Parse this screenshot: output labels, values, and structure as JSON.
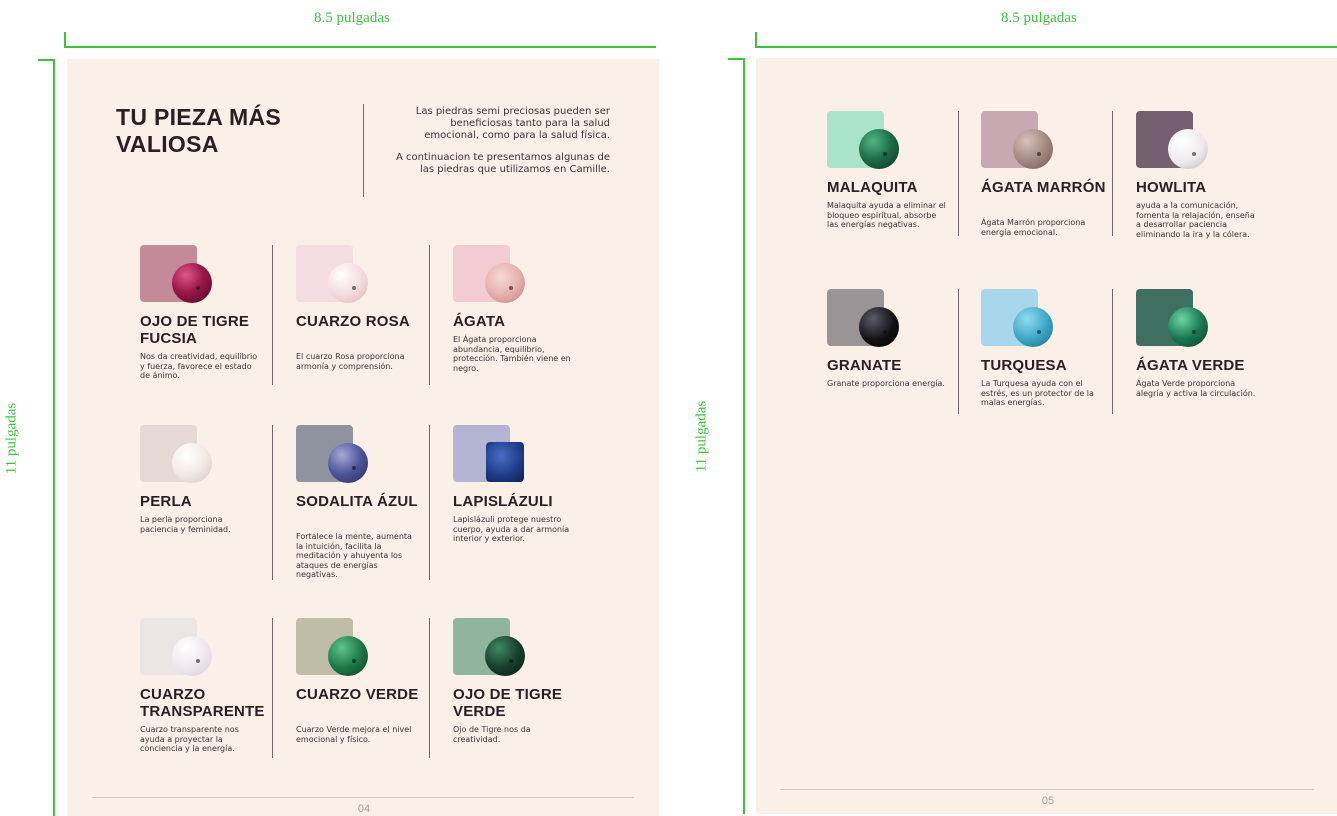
{
  "annotations": {
    "width_label": "8.5 pulgadas",
    "height_label": "11 pulgadas"
  },
  "colors": {
    "page_background": "#faf0e8",
    "measure_guides": "#3cc33c",
    "heading_text": "#2a1e22"
  },
  "page_left": {
    "title": "TU PIEZA MÁS VALIOSA",
    "intro_paragraph_1": "Las piedras semi preciosas pueden ser beneficiosas tanto para la salud emocional, como para la salud física.",
    "intro_paragraph_2": "A continuacion te presentamos algunas de las piedras que utilizamos en Camille.",
    "page_number": "04",
    "stones": [
      {
        "name": "OJO DE TIGRE FUCSIA",
        "description": "Nos da creatividad, equilibrio y fuerza, favorece el estado de ánimo.",
        "swatch_color": "#c48a99",
        "bead_color": "#9c1848"
      },
      {
        "name": "CUARZO ROSA",
        "description": "El cuarzo Rosa proporciona armonía y comprensión.",
        "swatch_color": "#f3dde3",
        "bead_color": "#f4dcdf"
      },
      {
        "name": "ÁGATA",
        "description": "El Ágata proporciona abundancia, equilibrio, protección. También viene en negro.",
        "swatch_color": "#f2ccd1",
        "bead_color": "#e8b6b4"
      },
      {
        "name": "PERLA",
        "description": "La perla proporciona paciencia y feminidad.",
        "swatch_color": "#e6d9d3",
        "bead_color": "#f2ebe8"
      },
      {
        "name": "SODALITA ÁZUL",
        "description": "Fortalece la mente, aumenta la intuición, facilita la meditación y ahuyenta los ataques de energías negativas.",
        "swatch_color": "#8d949f",
        "bead_color": "#4d5499"
      },
      {
        "name": "LAPISLÁZULI",
        "description": "Lapislázuli protege nuestro cuerpo, ayuda a dar armonía interior y exterior.",
        "swatch_color": "#b3b5d2",
        "bead_color": "#1f3d8a"
      },
      {
        "name": "CUARZO TRANSPARENTE",
        "description": "Cuarzo transparente nos ayuda a proyectar la conciencia y la energía.",
        "swatch_color": "#ebe6e4",
        "bead_color": "#efe9ee"
      },
      {
        "name": "CUARZO VERDE",
        "description": "Cuarzo Verde mejora el nivel emocional y físico.",
        "swatch_color": "#bfbca7",
        "bead_color": "#1f7a48"
      },
      {
        "name": "OJO DE TIGRE VERDE",
        "description": "Ojo de Tigre nos da creatividad.",
        "swatch_color": "#8fb59c",
        "bead_color": "#19402d"
      }
    ]
  },
  "page_right": {
    "page_number": "05",
    "stones": [
      {
        "name": "MALAQUITA",
        "description": "Malaquita ayuda a eliminar el bloqueo espiritual, absorbe las energías negativas.",
        "swatch_color": "#a9e4c8",
        "bead_color": "#1c6b45"
      },
      {
        "name": "ÁGATA MARRÓN",
        "description": "Ágata Marrón proporciona energía emocional.",
        "swatch_color": "#c9a9b1",
        "bead_color": "#a48a82"
      },
      {
        "name": "HOWLITA",
        "description": "ayuda a la comunicación, fomenta la relajación, enseña a desarrollar paciencia eliminando la ira y la cólera.",
        "swatch_color": "#75606f",
        "bead_color": "#eeeaec"
      },
      {
        "name": "GRANATE",
        "description": "Granate proporciona energía.",
        "swatch_color": "#9a9497",
        "bead_color": "#121216"
      },
      {
        "name": "TURQUESA",
        "description": "La Turquesa ayuda con el estrés, es un protector de la malas energías.",
        "swatch_color": "#a8d6ea",
        "bead_color": "#3aa4c4"
      },
      {
        "name": "ÁGATA VERDE",
        "description": "Ágata Verde proporciona alegría y activa la circulación.",
        "swatch_color": "#3e6f61",
        "bead_color": "#1a7a52"
      }
    ]
  }
}
